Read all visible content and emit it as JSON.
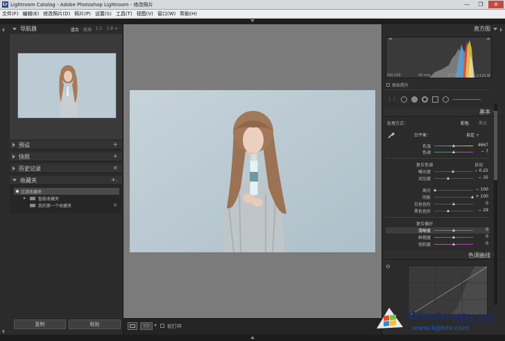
{
  "window": {
    "title": "Lightroom Catalog - Adobe Photoshop Lightroom - 修改照片",
    "app_icon": "Lr",
    "controls": [
      "—",
      "❐",
      "✕"
    ]
  },
  "menu": [
    "文件(F)",
    "编辑(E)",
    "修改照片(D)",
    "照片(P)",
    "设置(S)",
    "工具(T)",
    "视图(V)",
    "窗口(W)",
    "帮助(H)"
  ],
  "left_panel": {
    "navigator": {
      "title": "导航器",
      "options": [
        "适合",
        "填满",
        "1:1",
        "1:8 ≑"
      ]
    },
    "panels": [
      {
        "name": "预设",
        "action": "+"
      },
      {
        "name": "快照",
        "action": "+"
      },
      {
        "name": "历史记录",
        "action": "×"
      },
      {
        "name": "收藏夹",
        "action": "+."
      }
    ],
    "collections": [
      {
        "name": "过滤收藏夹",
        "count": ""
      },
      {
        "name": "智能收藏夹",
        "count": ""
      },
      {
        "name": "我的第一个收藏夹",
        "count": "0"
      }
    ],
    "copy_button": "复制",
    "paste_button": "粘贴"
  },
  "toolbar": {
    "softproof_label": "软打样"
  },
  "right_panel": {
    "histogram": {
      "title": "直方图",
      "iso": "ISO 100",
      "focal": "45 mm",
      "aperture": "ƒ / 7.1",
      "shutter": "1/125 秒",
      "original_photo": "原始照片"
    },
    "basic": {
      "title": "基本",
      "treatment_label": "处理方式：",
      "treatment_color": "彩色",
      "treatment_bw": "黑白",
      "wb_label": "白平衡：",
      "wb_value": "自定 ÷",
      "temp_label": "色温",
      "temp_value": "4667",
      "tint_label": "色调",
      "tint_value": "− 7",
      "tone_title": "复位色调",
      "auto_label": "自动",
      "exposure_label": "曝光度",
      "exposure_value": "− 0.25",
      "contrast_label": "对比度",
      "contrast_value": "− 35",
      "highlights_label": "高光",
      "highlights_value": "− 100",
      "shadows_label": "阴影",
      "shadows_value": "+ 100",
      "whites_label": "白色色阶",
      "whites_value": "0",
      "blacks_label": "黑色色阶",
      "blacks_value": "− 29",
      "presence_title": "复位偏好",
      "clarity_label": "清晰度",
      "clarity_value": "0",
      "vibrance_label": "鲜艳度",
      "vibrance_value": "0",
      "saturation_label": "饱和度",
      "saturation_value": "0"
    },
    "tone_curve": {
      "title": "色调曲线"
    }
  },
  "watermark": {
    "brand": "Windows",
    "cn": "系统之家",
    "url": "www.bjjmlv.com"
  }
}
